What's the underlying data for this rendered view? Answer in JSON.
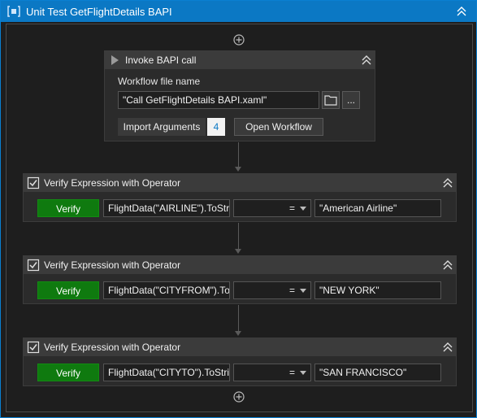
{
  "window": {
    "title": "Unit Test GetFlightDetails BAPI"
  },
  "invoke": {
    "title": "Invoke BAPI call",
    "file_label": "Workflow file name",
    "file_value": "\"Call GetFlightDetails BAPI.xaml\"",
    "browse_label": "",
    "more_label": "...",
    "import_label": "Import Arguments",
    "import_count": "4",
    "open_label": "Open Workflow"
  },
  "verifies": [
    {
      "title": "Verify Expression with Operator",
      "button": "Verify",
      "expression": "FlightData(\"AIRLINE\").ToStr",
      "operator": "=",
      "value": "\"American Airline\""
    },
    {
      "title": "Verify Expression with Operator",
      "button": "Verify",
      "expression": "FlightData(\"CITYFROM\").To",
      "operator": "=",
      "value": "\"NEW YORK\""
    },
    {
      "title": "Verify Expression with Operator",
      "button": "Verify",
      "expression": "FlightData(\"CITYTO\").ToStri",
      "operator": "=",
      "value": "\"SAN FRANCISCO\""
    }
  ],
  "icons": {
    "sequence": "sequence-icon",
    "collapse": "double-chevron-up-icon",
    "add": "plus-circle-icon",
    "play": "play-icon",
    "check": "checkbox-checked-icon",
    "folder": "folder-icon"
  },
  "colors": {
    "accent": "#0b78c4",
    "verify": "#0f7a0f",
    "background": "#1e1e1e"
  }
}
